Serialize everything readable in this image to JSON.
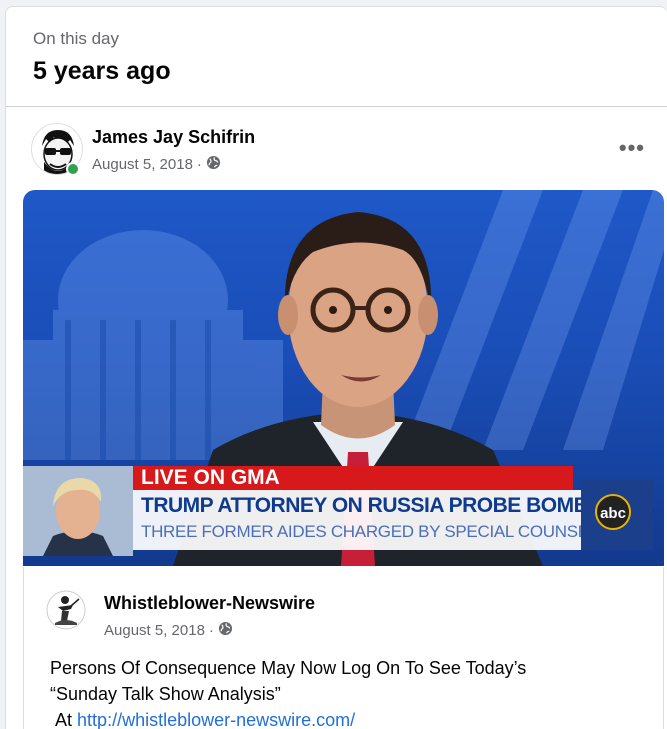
{
  "memory": {
    "kicker": "On this day",
    "headline": "5 years ago"
  },
  "post": {
    "author": "James Jay Schifrin",
    "date": "August 5, 2018",
    "separator": "·",
    "privacy_icon": "globe-icon",
    "more_label": "•••",
    "online_status_color": "#31a24c"
  },
  "media": {
    "live_label": "LIVE ON GMA",
    "headline_line1": "TRUMP ATTORNEY ON RUSSIA PROBE BOMBSHELL",
    "headline_line2": "THREE FORMER AIDES CHARGED BY SPECIAL COUNSEL",
    "network_logo": "abc"
  },
  "shared": {
    "page_name": "Whistleblower-Newswire",
    "date": "August 5, 2018",
    "separator": "·",
    "line1": "Persons Of Consequence May Now Log On To See Today’s",
    "line2": "“Sunday Talk Show Analysis”",
    "line3_prefix": "At",
    "link": "http://whistleblower-newswire.com/"
  },
  "colors": {
    "link": "#216fdb",
    "secondary_text": "#65676b",
    "live_red": "#d7191c"
  }
}
